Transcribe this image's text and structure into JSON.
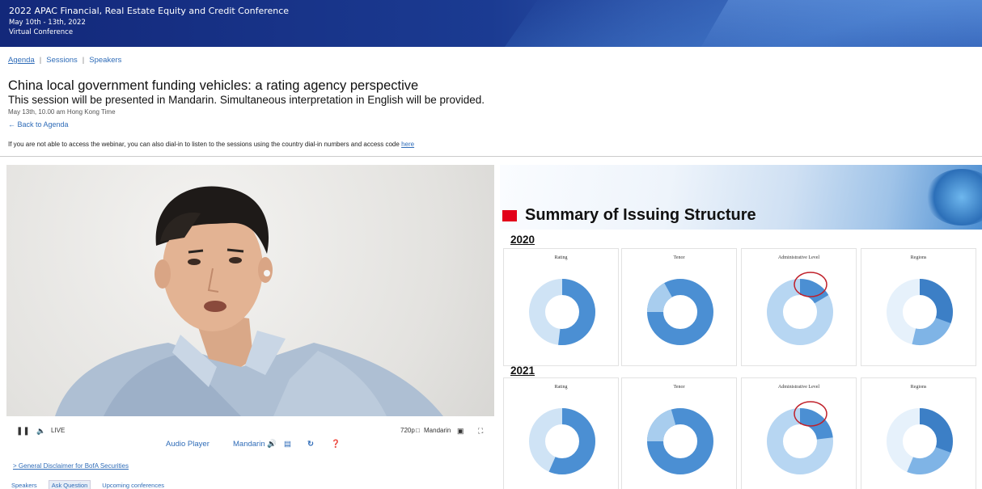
{
  "banner": {
    "line1": "2022 APAC Financial, Real Estate Equity and Credit Conference",
    "line2": "May 10th - 13th, 2022",
    "line3": "Virtual Conference"
  },
  "nav": {
    "agenda": "Agenda",
    "sessions": "Sessions",
    "speakers": "Speakers",
    "separator": "|"
  },
  "session": {
    "title": "China local government funding vehicles: a rating agency perspective",
    "subtitle": "This session will be presented in Mandarin. Simultaneous interpretation in English will be provided.",
    "date": "May 13th, 10.00 am Hong Kong Time",
    "back": "Back to Agenda",
    "dialin_text": "If you are not able to access the webinar, you can also dial-in to listen to the sessions using the country dial-in numbers and access code",
    "dialin_link": "here"
  },
  "player": {
    "live": "LIVE",
    "quality": "720p",
    "language": "Mandarin",
    "audio_player": "Audio Player",
    "mandarin_btn": "Mandarin",
    "colors": {
      "video_bg": "#e8e6e4"
    }
  },
  "footer": {
    "disclaimer": "General Disclaimer for BofA Securities",
    "tabs": [
      "Speakers",
      "Ask Question",
      "Upcoming conferences"
    ]
  },
  "slide": {
    "title": "Summary of Issuing Structure",
    "year_2020": "2020",
    "year_2021": "2021",
    "chart_titles": [
      "Rating",
      "Tenor",
      "Administrative Level",
      "Regions"
    ]
  }
}
